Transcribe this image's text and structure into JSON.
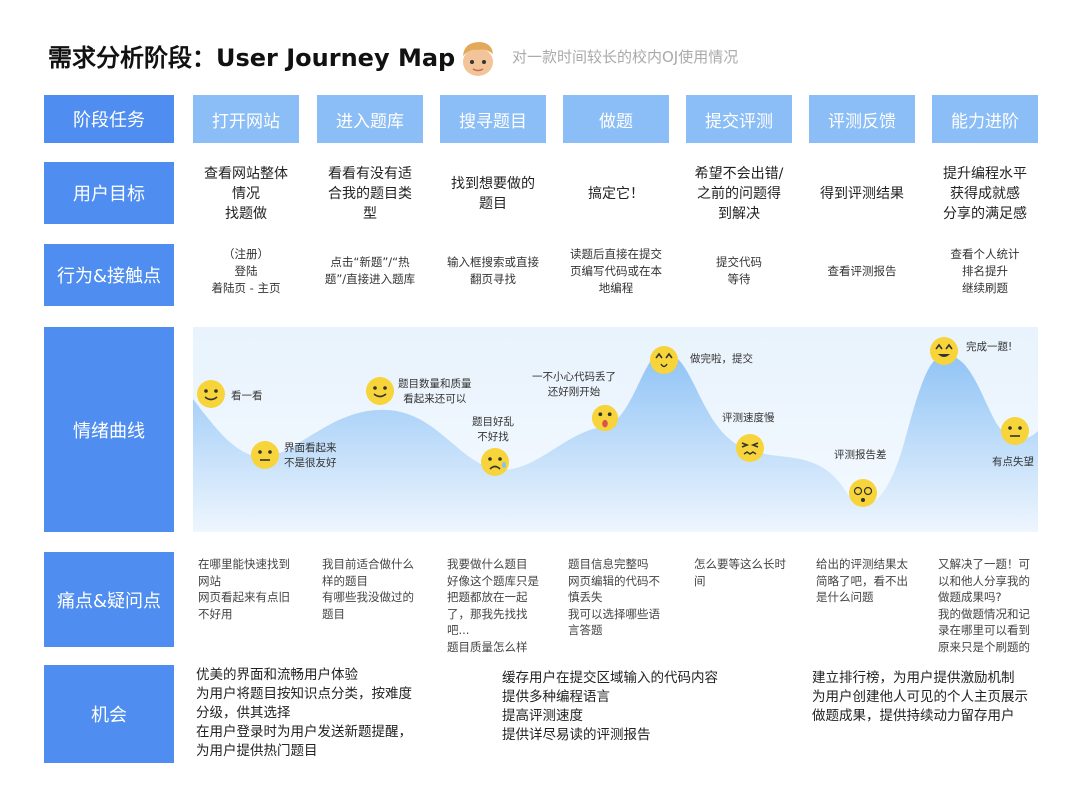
{
  "header": {
    "title": "需求分析阶段：User Journey Map",
    "subtitle": "对一款时间较长的校内OJ使用情况"
  },
  "rows": {
    "stage_label": "阶段任务",
    "goal_label": "用户目标",
    "touch_label": "行为&接触点",
    "emotion_label": "情绪曲线",
    "pain_label": "痛点&疑问点",
    "opportunity_label": "机会"
  },
  "stages": [
    "打开网站",
    "进入题库",
    "搜寻题目",
    "做题",
    "提交评测",
    "评测反馈",
    "能力进阶"
  ],
  "goals": [
    "查看网站整体\n情况\n找题做",
    "看看有没有适\n合我的题目类\n型",
    "找到想要做的\n题目",
    "搞定它！",
    "希望不会出错/\n之前的问题得\n到解决",
    "得到评测结果",
    "提升编程水平\n获得成就感\n分享的满足感"
  ],
  "touchpoints": [
    "（注册）\n登陆\n着陆页 - 主页",
    "点击“新题”/“热\n题”/直接进入题库",
    "输入框搜索或直接\n翻页寻找",
    "读题后直接在提交\n页编写代码或在本\n地编程",
    "提交代码\n等待",
    "查看评测报告",
    "查看个人统计\n排名提升\n继续刷题"
  ],
  "emotions": [
    {
      "text": "看一看",
      "mood": "smile"
    },
    {
      "text": "界面看起来\n不是很友好",
      "mood": "meh"
    },
    {
      "text": "题目数量和质量\n看起来还可以",
      "mood": "smile"
    },
    {
      "text": "题目好乱\n不好找",
      "mood": "sad"
    },
    {
      "text": "一不小心代码丢了\n还好刚开始",
      "mood": "shock"
    },
    {
      "text": "做完啦，提交",
      "mood": "happy"
    },
    {
      "text": "评测速度慢",
      "mood": "annoyed"
    },
    {
      "text": "评测报告差",
      "mood": "dizzy"
    },
    {
      "text": "完成一题!",
      "mood": "happy"
    },
    {
      "text": "有点失望",
      "mood": "meh"
    }
  ],
  "pains": [
    "在哪里能快速找到\n网站\n网页看起来有点旧\n不好用",
    "我目前适合做什么\n样的题目\n有哪些我没做过的\n题目",
    "我要做什么题目\n好像这个题库只是\n把题都放在一起\n了，那我先找找\n吧...\n题目质量怎么样",
    "题目信息完整吗\n网页编辑的代码不\n慎丢失\n我可以选择哪些语\n言答题",
    "怎么要等这么长时\n间",
    "给出的评测结果太\n简略了吧，看不出\n是什么问题",
    "又解决了一题！可\n以和他人分享我的\n做题成果吗?\n我的做题情况和记\n录在哪里可以看到\n原来只是个刷题的"
  ],
  "opportunities": [
    "优美的界面和流畅用户体验\n为用户将题目按知识点分类，按难度\n分级，供其选择\n在用户登录时为用户发送新题提醒，\n为用户提供热门题目",
    "缓存用户在提交区域输入的代码内容\n提供多种编程语言\n提高评测速度\n提供详尽易读的评测报告",
    "建立排行榜，为用户提供激励机制\n为用户创建他人可见的个人主页展示\n做题成果，提供持续动力留存用户"
  ],
  "colors": {
    "label_blue": "#4f8ef0",
    "stage_blue": "#8bbdf6",
    "curve_blue": "#8fc3f5",
    "emoji_yellow": "#f7d43a"
  }
}
